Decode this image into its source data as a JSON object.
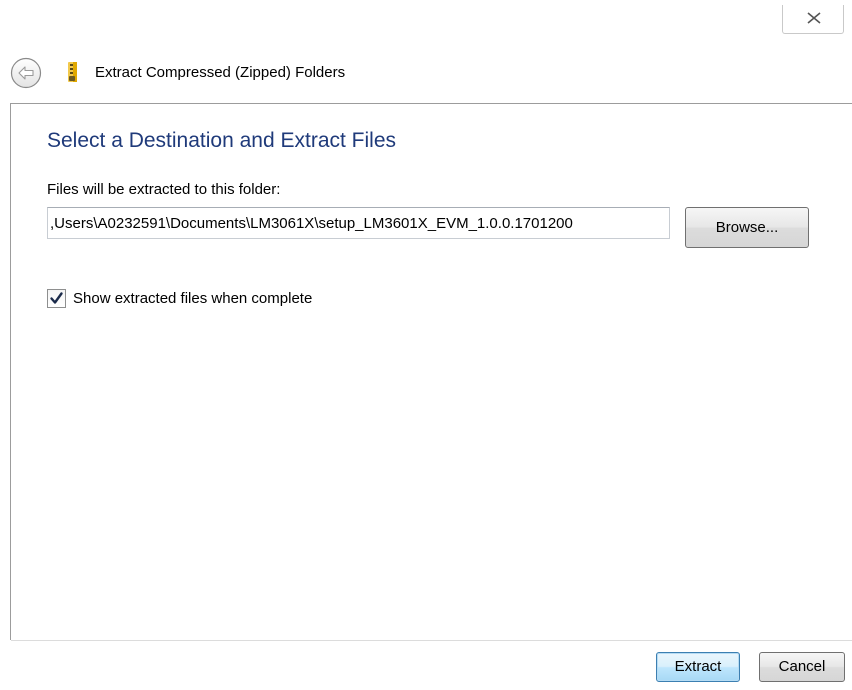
{
  "window": {
    "title": "Extract Compressed (Zipped) Folders"
  },
  "icons": {
    "close": "close-icon",
    "back": "back-arrow-icon",
    "zip": "zip-folder-icon",
    "checkmark": "checkmark-icon"
  },
  "main": {
    "heading": "Select a Destination and Extract Files",
    "folder_label": "Files will be extracted to this folder:",
    "path_value": ",Users\\A0232591\\Documents\\LM3061X\\setup_LM3601X_EVM_1.0.0.1701200",
    "browse_label": "Browse...",
    "show_files_label": "Show extracted files when complete",
    "show_files_checked": true
  },
  "footer": {
    "extract_label": "Extract",
    "cancel_label": "Cancel"
  },
  "colors": {
    "heading": "#1f3a7a",
    "default_button_border": "#3c7fb1"
  }
}
